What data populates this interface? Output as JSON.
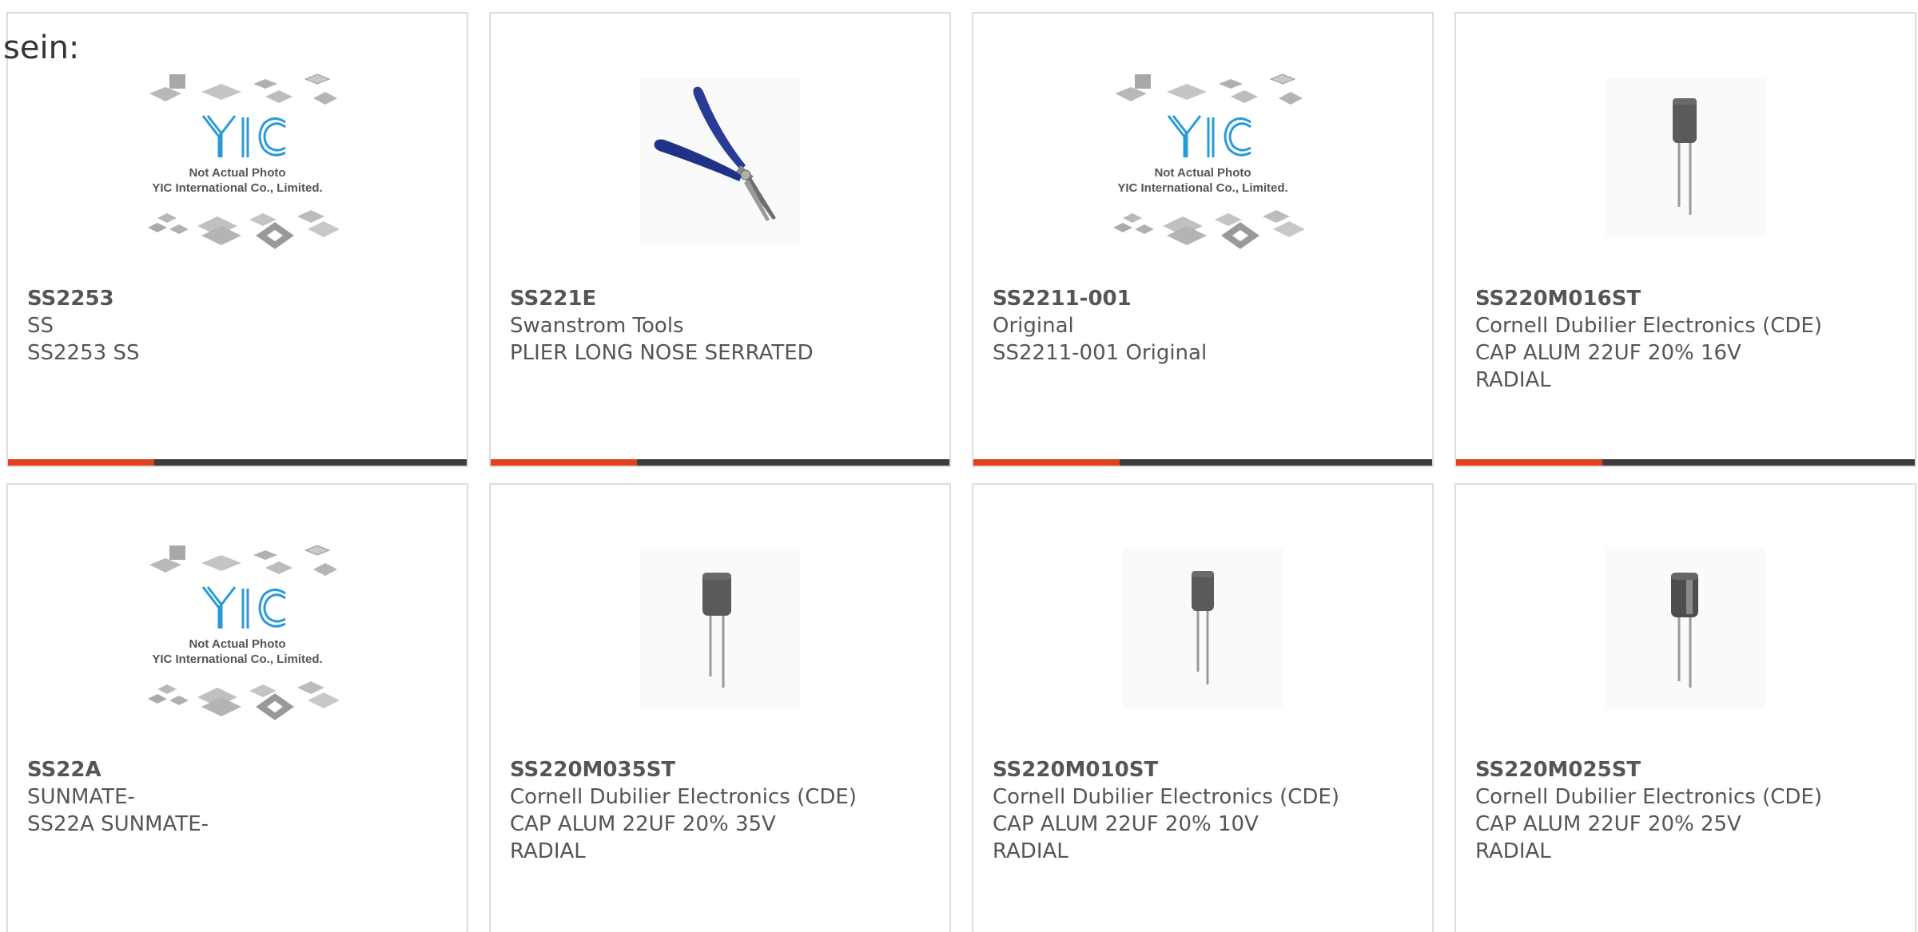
{
  "intro_text": "sein:",
  "colors": {
    "accent": "#e0401c",
    "bar_dark": "#3d3d3d",
    "border": "#dddddd",
    "text": "#555555",
    "yic_blue": "#2a9ad6"
  },
  "placeholder": {
    "line1": "Not Actual Photo",
    "line2": "YIC International Co., Limited.",
    "logo": "YIC"
  },
  "products": [
    {
      "part_number": "SS2253",
      "manufacturer": "SS",
      "description": "SS2253 SS",
      "description2": "",
      "image": "yic-placeholder-image"
    },
    {
      "part_number": "SS221E",
      "manufacturer": "Swanstrom Tools",
      "description": "PLIER LONG NOSE SERRATED",
      "description2": "",
      "image": "pliers-image"
    },
    {
      "part_number": "SS2211-001",
      "manufacturer": "Original",
      "description": "SS2211-001 Original",
      "description2": "",
      "image": "yic-placeholder-image"
    },
    {
      "part_number": "SS220M016ST",
      "manufacturer": "Cornell Dubilier Electronics (CDE)",
      "description": "CAP ALUM 22UF 20% 16V",
      "description2": "RADIAL",
      "image": "capacitor-image"
    },
    {
      "part_number": "SS22A",
      "manufacturer": "SUNMATE-",
      "description": "SS22A SUNMATE-",
      "description2": "",
      "image": "yic-placeholder-image"
    },
    {
      "part_number": "SS220M035ST",
      "manufacturer": "Cornell Dubilier Electronics (CDE)",
      "description": "CAP ALUM 22UF 20% 35V",
      "description2": "RADIAL",
      "image": "capacitor-image"
    },
    {
      "part_number": "SS220M010ST",
      "manufacturer": "Cornell Dubilier Electronics (CDE)",
      "description": "CAP ALUM 22UF 20% 10V",
      "description2": "RADIAL",
      "image": "capacitor-image"
    },
    {
      "part_number": "SS220M025ST",
      "manufacturer": "Cornell Dubilier Electronics (CDE)",
      "description": "CAP ALUM 22UF 20% 25V",
      "description2": "RADIAL",
      "image": "capacitor-image"
    }
  ]
}
